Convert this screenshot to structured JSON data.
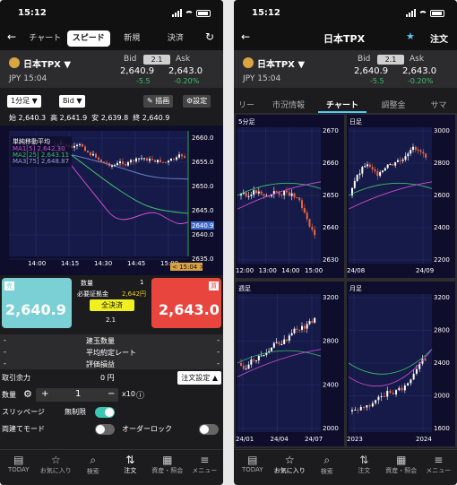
{
  "status": {
    "time": "15:12"
  },
  "left": {
    "tabs": [
      "チャート",
      "スピード",
      "新規",
      "決済"
    ],
    "active_tab": "スピード",
    "symbol": "日本TPX ▼",
    "currency_time": "JPY 15:04",
    "bid_label": "Bid",
    "spread": "2.1",
    "ask_label": "Ask",
    "bid": "2,640.9",
    "ask": "2,643.0",
    "bid_change": "-5.5",
    "ask_change": "-0.20%",
    "timeframe": "1分足 ▼",
    "side": "Bid ▼",
    "draw_label": "描画",
    "settings_label": "設定",
    "ohlc": [
      "始 2,640.3",
      "高 2,641.9",
      "安 2,639.8",
      "終 2,640.9"
    ],
    "chart": {
      "ma_title": "単純移動平均",
      "ma_lines": [
        "MA1[5] 2,642.30",
        "MA2[25] 2,643.11",
        "MA3[75] 2,648.87"
      ],
      "y_ticks": [
        "2660.0",
        "2655.0",
        "2650.0",
        "2645.0",
        "2640.0",
        "2635.0"
      ],
      "x_ticks": [
        "14:00",
        "14:15",
        "14:30",
        "14:45",
        "15:00"
      ],
      "price_tag": "2640.9",
      "time_tag": "< 15:04 >"
    },
    "sell_tag": "売",
    "buy_tag": "買",
    "sell_price": "2,640.9",
    "buy_price": "2,643.0",
    "qty_label": "数量",
    "qty_value": "1",
    "margin_label": "必要証拠金",
    "margin_value": "2,642円",
    "close_all": "全決済",
    "spread2": "2.1",
    "info_rows": [
      {
        "label": "建玉数量",
        "left": "-",
        "right": "-"
      },
      {
        "label": "平均約定レート",
        "left": "-",
        "right": "-"
      },
      {
        "label": "評価損益",
        "left": "-",
        "right": "-"
      }
    ],
    "avail_label": "取引余力",
    "avail_value": "0 円",
    "order_settings": "注文設定 ▲",
    "qty2_label": "数量",
    "qty2_value": "1",
    "mult": "x10",
    "slippage_label": "スリッページ",
    "slippage_value": "無制限",
    "both_label": "両建てモード",
    "overlock_label": "オーダーロック"
  },
  "right": {
    "title": "日本TPX",
    "order": "注文",
    "tabs": [
      "リー",
      "市況情報",
      "チャート",
      "調整金",
      "サマ"
    ],
    "active_tab": "チャート",
    "panes": [
      {
        "title": "5分足",
        "y": [
          "2670",
          "2660",
          "2650",
          "2640",
          "2630"
        ],
        "x": [
          "12:00",
          "13:00",
          "14:00",
          "15:00"
        ]
      },
      {
        "title": "日足",
        "y": [
          "3000",
          "2800",
          "2600",
          "2400",
          "2200"
        ],
        "x": [
          "24/08",
          "24/09"
        ]
      },
      {
        "title": "週足",
        "y": [
          "3200",
          "2800",
          "2400",
          "2000"
        ],
        "x": [
          "24/01",
          "24/04",
          "24/07"
        ]
      },
      {
        "title": "月足",
        "y": [
          "3200",
          "2800",
          "2400",
          "2000",
          "1600"
        ],
        "x": [
          "2023",
          "2024"
        ]
      }
    ]
  },
  "bottom_nav": [
    {
      "icon": "home-icon",
      "label": "TODAY"
    },
    {
      "icon": "star-icon",
      "label": "お気に入り"
    },
    {
      "icon": "search-icon",
      "label": "検索"
    },
    {
      "icon": "trade-icon",
      "label": "注文"
    },
    {
      "icon": "assets-icon",
      "label": "資産・照会"
    },
    {
      "icon": "menu-icon",
      "label": "メニュー"
    }
  ],
  "colors": {
    "sell": "#7ad0d4",
    "buy": "#e8453f",
    "up": "#ffffff",
    "down": "#e8663f",
    "ma1": "#d04fd0",
    "ma2": "#3fbf6a",
    "ma3": "#6a7fd0",
    "green": "#3fbf6a"
  }
}
